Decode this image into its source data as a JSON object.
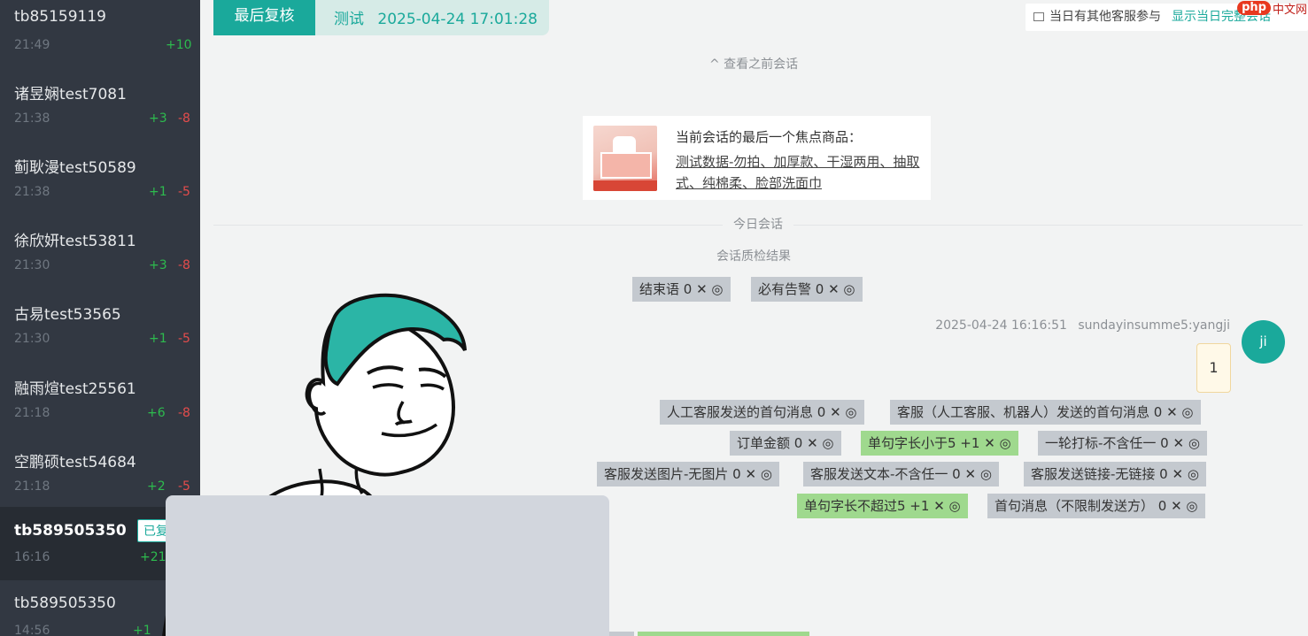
{
  "sidebar": {
    "conversations": [
      {
        "name": "tb85159119",
        "time": "21:49",
        "score_pos": "+10",
        "score_neg": ""
      },
      {
        "name": "诸昱娴test7081",
        "time": "21:38",
        "score_pos": "+3",
        "score_neg": "-8"
      },
      {
        "name": "蓟耿漫test50589",
        "time": "21:38",
        "score_pos": "+1",
        "score_neg": "-5"
      },
      {
        "name": "徐欣妍test53811",
        "time": "21:30",
        "score_pos": "+3",
        "score_neg": "-8"
      },
      {
        "name": "古易test53565",
        "time": "21:30",
        "score_pos": "+1",
        "score_neg": "-5"
      },
      {
        "name": "融雨煊test25561",
        "time": "21:18",
        "score_pos": "+6",
        "score_neg": "-8"
      },
      {
        "name": "空鹏硕test54684",
        "time": "21:18",
        "score_pos": "+2",
        "score_neg": "-5"
      },
      {
        "name": "tb589505350",
        "time": "16:16",
        "score_pos": "+21",
        "score_neg": "",
        "badge": "已复"
      },
      {
        "name": "tb589505350",
        "time": "14:56",
        "score_pos": "+1",
        "score_neg": ""
      }
    ]
  },
  "header": {
    "tab_active": "最后复核",
    "tab_user": "测试",
    "tab_datetime": "2025-04-24 17:01:28",
    "other_agents_label": "当日有其他客服参与",
    "other_agents_link": "显示当日完整会话"
  },
  "watermark": {
    "logo": "php",
    "text": "中文网"
  },
  "chat": {
    "prev_link": "^ 查看之前会话",
    "product": {
      "title": "当前会话的最后一个焦点商品：",
      "name": "测试数据-勿拍、加厚款、干湿两用、抽取式、纯棉柔、脸部洗面巾"
    },
    "day_label": "今日会话",
    "qc_label": "会话质检结果",
    "session_tags": [
      {
        "label": "结束语 0 ✕ ◎",
        "color": "gray"
      },
      {
        "label": "必有告警 0 ✕ ◎",
        "color": "gray"
      }
    ],
    "message": {
      "timestamp": "2025-04-24 16:16:51",
      "sender": "sundayinsumme5:yangji",
      "avatar_text": "ji",
      "text": "1"
    },
    "message_tags": [
      {
        "label": "人工客服发送的首句消息 0 ✕ ◎",
        "color": "gray"
      },
      {
        "label": "客服（人工客服、机器人）发送的首句消息 0 ✕ ◎",
        "color": "gray"
      },
      {
        "label": "订单金额 0 ✕ ◎",
        "color": "gray"
      },
      {
        "label": "单句字长小于5 +1 ✕ ◎",
        "color": "green"
      },
      {
        "label": "一轮打标-不含任一 0 ✕ ◎",
        "color": "gray"
      },
      {
        "label": "客服发送图片-无图片 0 ✕ ◎",
        "color": "gray"
      },
      {
        "label": "客服发送文本-不含任一 0 ✕ ◎",
        "color": "gray"
      },
      {
        "label": "客服发送链接-无链接 0 ✕ ◎",
        "color": "gray"
      },
      {
        "label": "单句字长不超过5 +1 ✕ ◎",
        "color": "green"
      },
      {
        "label": "首句消息（不限制发送方） 0 ✕ ◎",
        "color": "gray"
      }
    ]
  },
  "colors": {
    "accent": "#1aa99b",
    "sidebar_bg": "#323842",
    "positive": "#2dbb4e",
    "negative": "#e44c4c",
    "tag_gray": "#c4c9cf",
    "tag_green": "#9fd98e"
  },
  "icons": {
    "other_agents": "window-icon",
    "prev_link": "chevron-up-icon",
    "tag_remove": "close-icon",
    "tag_view": "eye-icon"
  }
}
